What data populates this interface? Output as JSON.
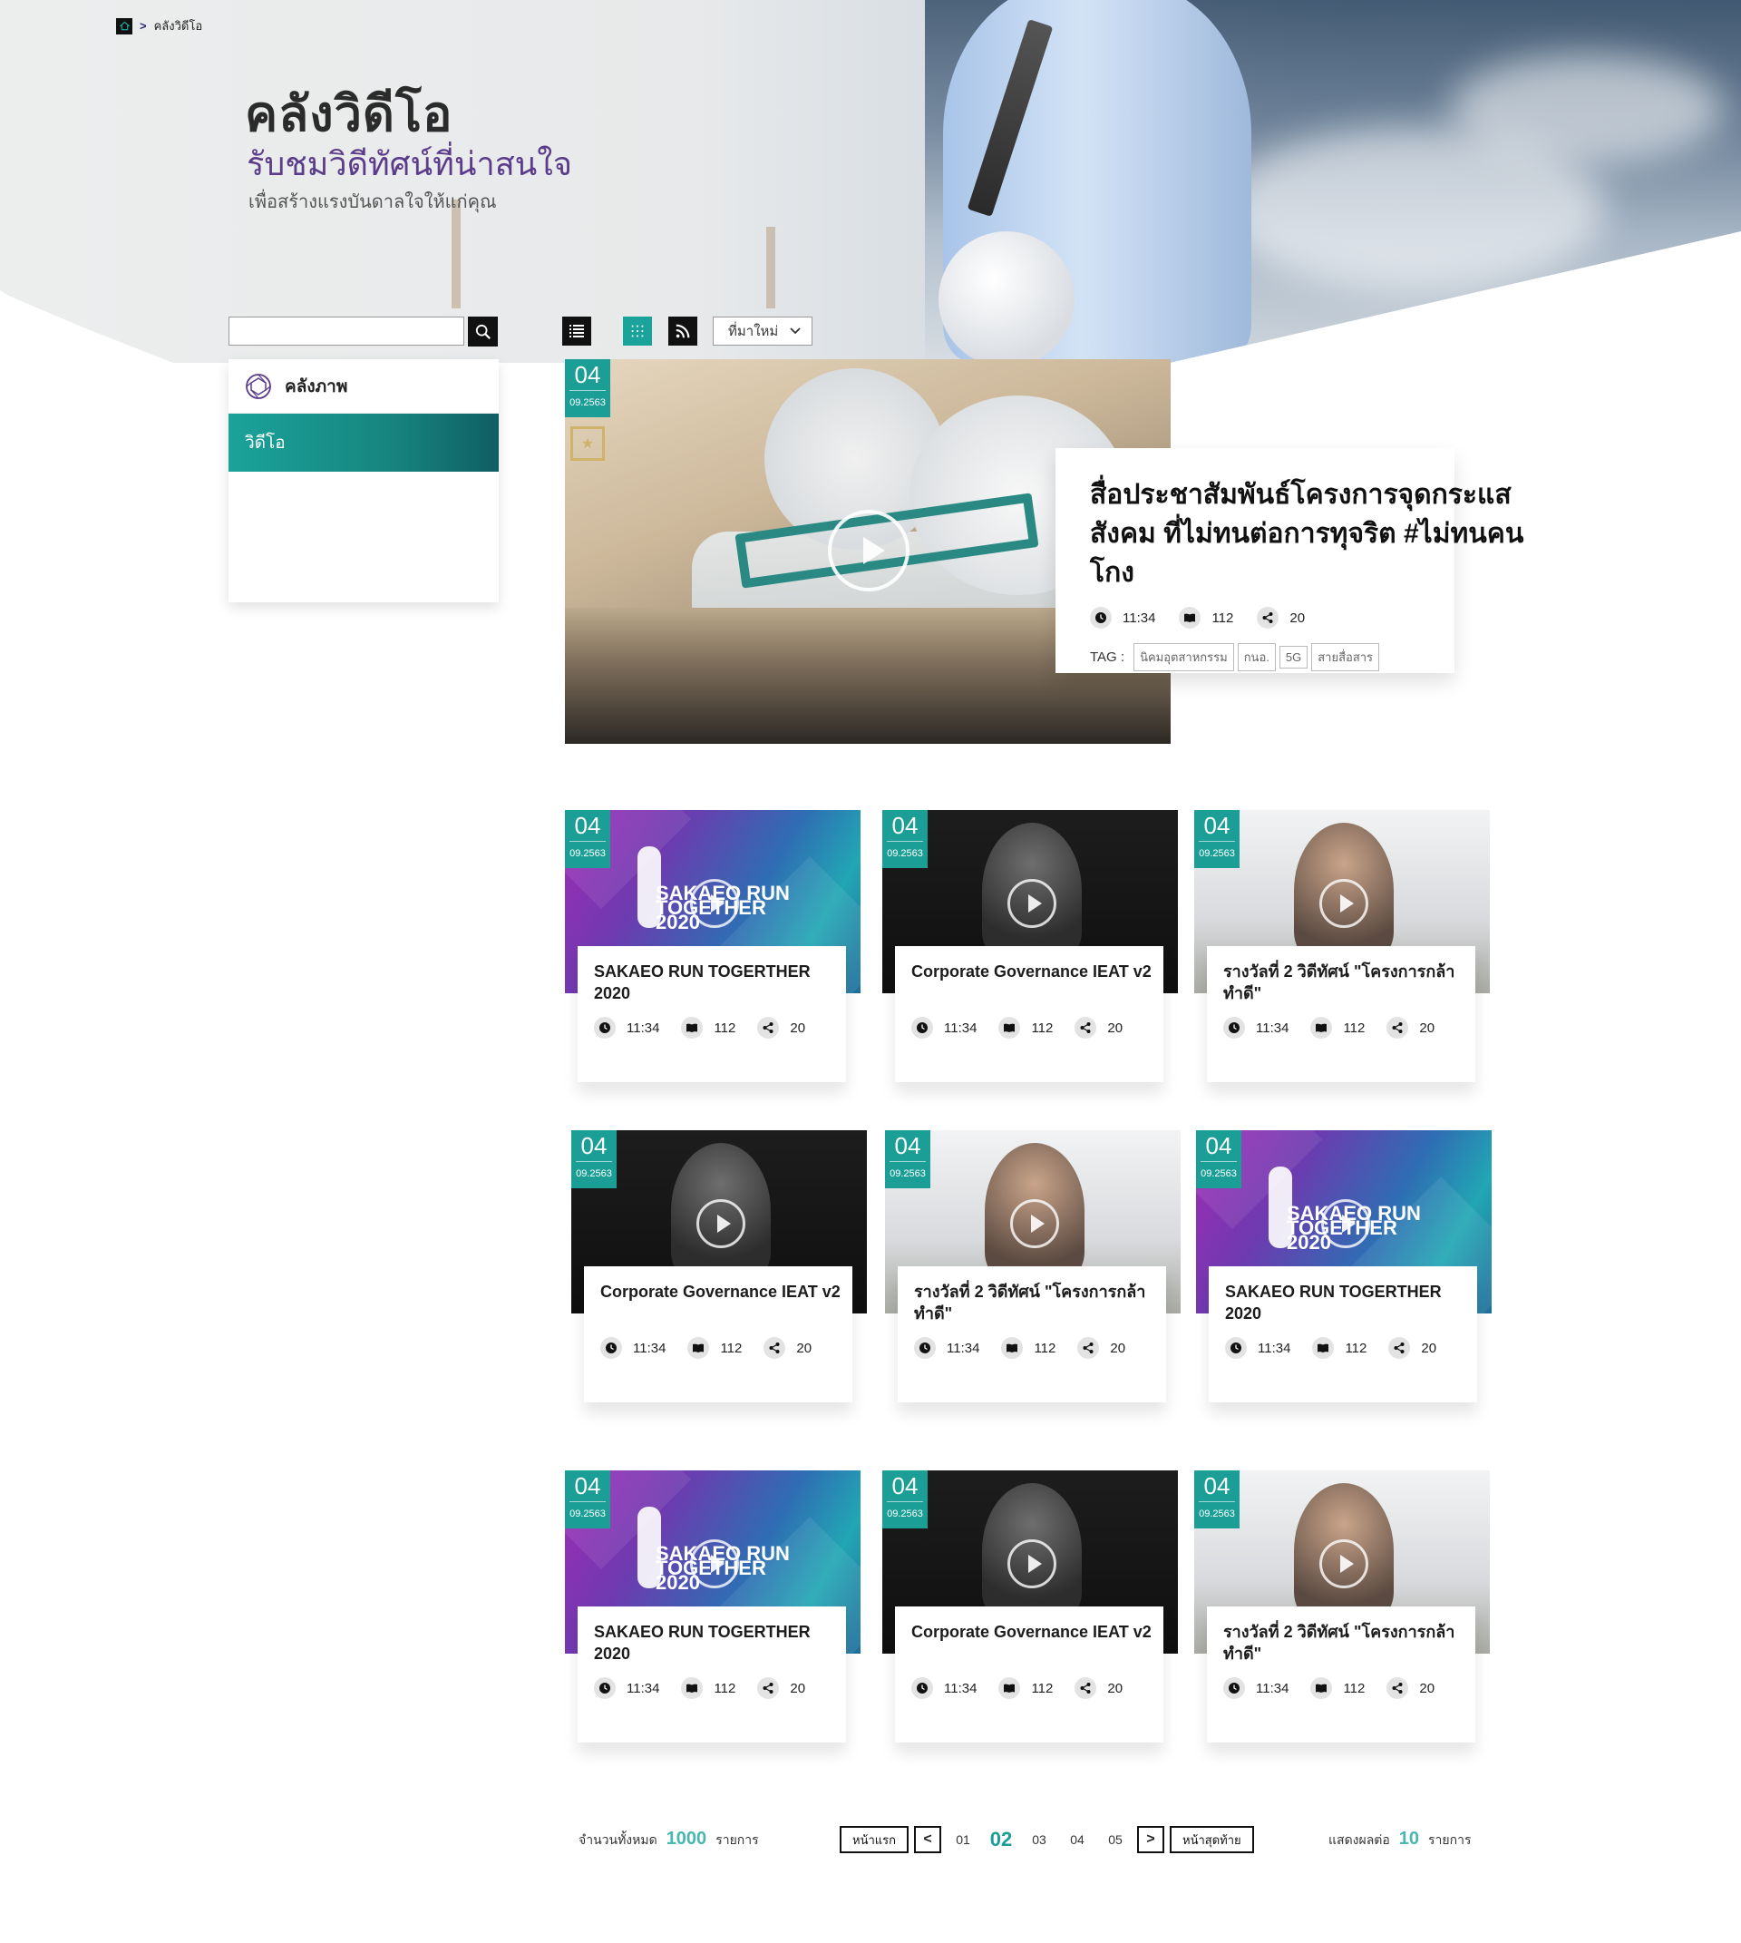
{
  "breadcrumb": {
    "current": "คลังวิดีโอ"
  },
  "hero": {
    "title": "คลังวิดีโอ",
    "subtitle": "รับชมวิดีทัศน์ที่น่าสนใจ",
    "tagline": "เพื่อสร้างแรงบันดาลใจให้แก่คุณ"
  },
  "toolbar": {
    "search_placeholder": "",
    "sort_value": "ที่มาใหม่"
  },
  "sidebar": {
    "items": [
      {
        "label": "คลังภาพ",
        "icon": "aperture-icon",
        "active": false
      },
      {
        "label": "วิดีโอ",
        "active": true
      }
    ]
  },
  "featured": {
    "day": "04",
    "month": "09.2563",
    "title": "สื่อประชาสัมพันธ์โครงการจุดกระแสสังคม ที่ไม่ทนต่อการทุจริต #ไม่ทนคนโกง",
    "duration": "11:34",
    "views": "112",
    "shares": "20",
    "tag_label": "TAG :",
    "tags": [
      "นิคมอุตสาหกรรม",
      "กนอ.",
      "5G",
      "สายสื่อสาร"
    ]
  },
  "cards": [
    {
      "day": "04",
      "month": "09.2563",
      "title": "SAKAEO RUN TOGERTHER 2020",
      "duration": "11:34",
      "views": "112",
      "shares": "20",
      "style": "run"
    },
    {
      "day": "04",
      "month": "09.2563",
      "title": "Corporate Governance IEAT v2",
      "duration": "11:34",
      "views": "112",
      "shares": "20",
      "style": "dark"
    },
    {
      "day": "04",
      "month": "09.2563",
      "title": "รางวัลที่ 2 วิดีทัศน์ \"โครงการกล้าทำดี\"",
      "duration": "11:34",
      "views": "112",
      "shares": "20",
      "style": "light"
    },
    {
      "day": "04",
      "month": "09.2563",
      "title": "Corporate Governance IEAT v2",
      "duration": "11:34",
      "views": "112",
      "shares": "20",
      "style": "dark"
    },
    {
      "day": "04",
      "month": "09.2563",
      "title": "รางวัลที่ 2 วิดีทัศน์ \"โครงการกล้าทำดี\"",
      "duration": "11:34",
      "views": "112",
      "shares": "20",
      "style": "light"
    },
    {
      "day": "04",
      "month": "09.2563",
      "title": "SAKAEO RUN TOGERTHER 2020",
      "duration": "11:34",
      "views": "112",
      "shares": "20",
      "style": "run"
    },
    {
      "day": "04",
      "month": "09.2563",
      "title": "SAKAEO RUN TOGERTHER 2020",
      "duration": "11:34",
      "views": "112",
      "shares": "20",
      "style": "run"
    },
    {
      "day": "04",
      "month": "09.2563",
      "title": "Corporate Governance IEAT v2",
      "duration": "11:34",
      "views": "112",
      "shares": "20",
      "style": "dark"
    },
    {
      "day": "04",
      "month": "09.2563",
      "title": "รางวัลที่ 2 วิดีทัศน์ \"โครงการกล้าทำดี\"",
      "duration": "11:34",
      "views": "112",
      "shares": "20",
      "style": "light"
    }
  ],
  "run_logo_text": {
    "line1": "SAKAEO RUN",
    "line2": "TOGETHER",
    "line3": "2020"
  },
  "pagination": {
    "total_label": "จำนวนทั้งหมด",
    "total_value": "1000",
    "total_unit": "รายการ",
    "first_label": "หน้าแรก",
    "last_label": "หน้าสุดท้าย",
    "pages": [
      "01",
      "02",
      "03",
      "04",
      "05"
    ],
    "active_page": "02",
    "perpage_label": "แสดงผลต่อ",
    "perpage_value": "10",
    "perpage_unit": "รายการ"
  },
  "colors": {
    "accent": "#1a9e96",
    "purple": "#5b3c8a",
    "dark": "#111111"
  }
}
